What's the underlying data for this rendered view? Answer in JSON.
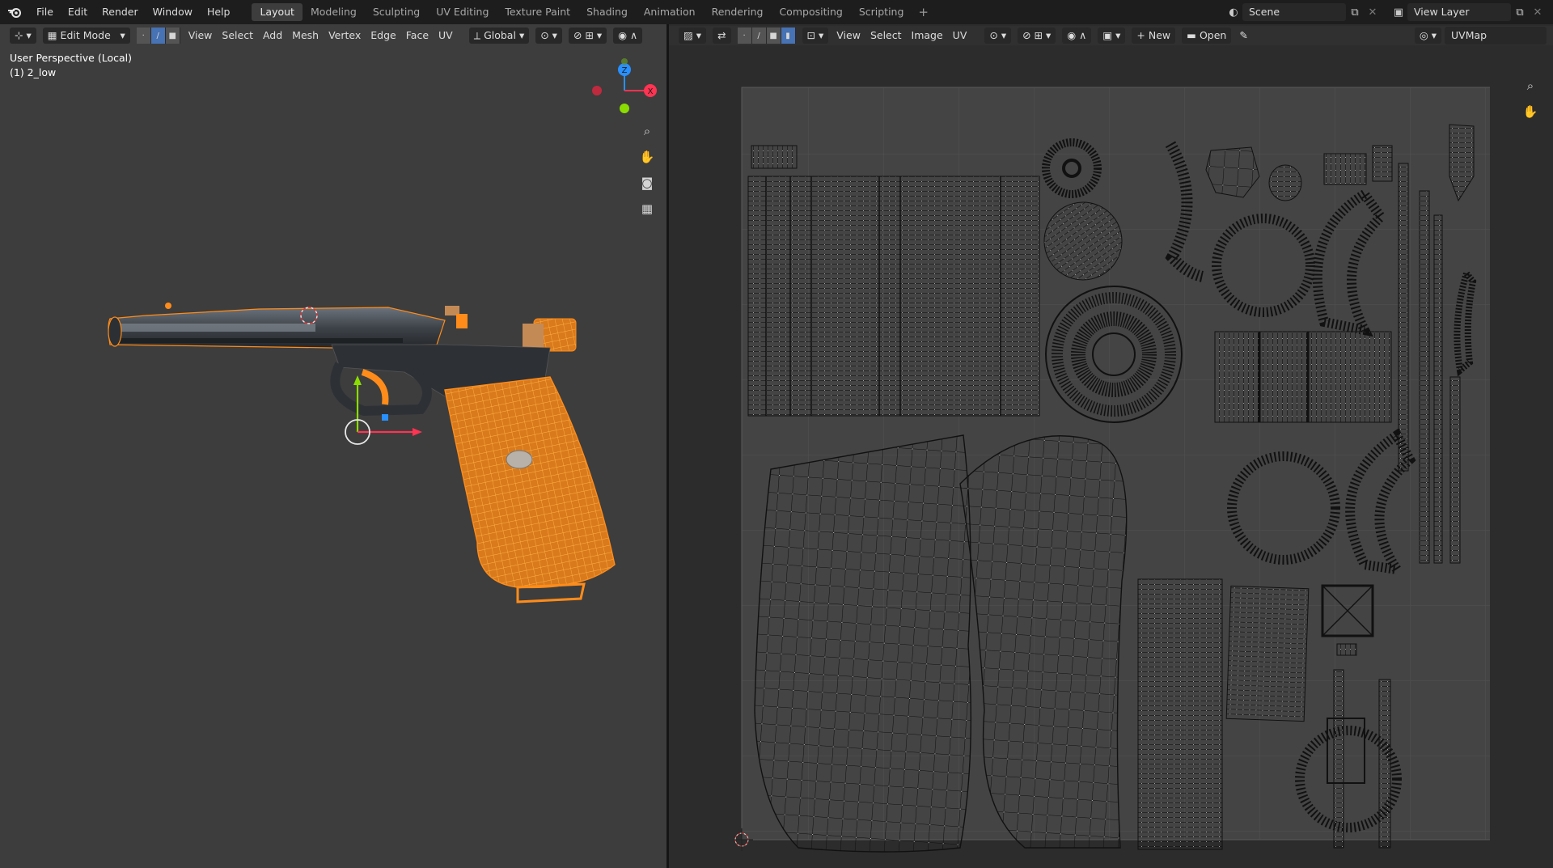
{
  "topbar": {
    "menus": [
      "File",
      "Edit",
      "Render",
      "Window",
      "Help"
    ],
    "workspaces": [
      "Layout",
      "Modeling",
      "Sculpting",
      "UV Editing",
      "Texture Paint",
      "Shading",
      "Animation",
      "Rendering",
      "Compositing",
      "Scripting"
    ],
    "active_workspace": "Layout",
    "add_tab": "+",
    "scene": "Scene",
    "view_layer": "View Layer"
  },
  "viewport3d": {
    "mode": "Edit Mode",
    "menus": [
      "View",
      "Select",
      "Add",
      "Mesh",
      "Vertex",
      "Edge",
      "Face",
      "UV"
    ],
    "orientation": "Global",
    "perspective_label": "User Perspective (Local)",
    "object_label": "(1) 2_low"
  },
  "uv_editor": {
    "menus": [
      "View",
      "Select",
      "Image",
      "UV"
    ],
    "new_label": "New",
    "open_label": "Open",
    "uvmap": "UVMap"
  },
  "colors": {
    "accent": "#4772b3",
    "selection_orange": "#ff8c1a",
    "axis_x": "#ff3352",
    "axis_y": "#8bdc00",
    "axis_z": "#2890ff"
  }
}
